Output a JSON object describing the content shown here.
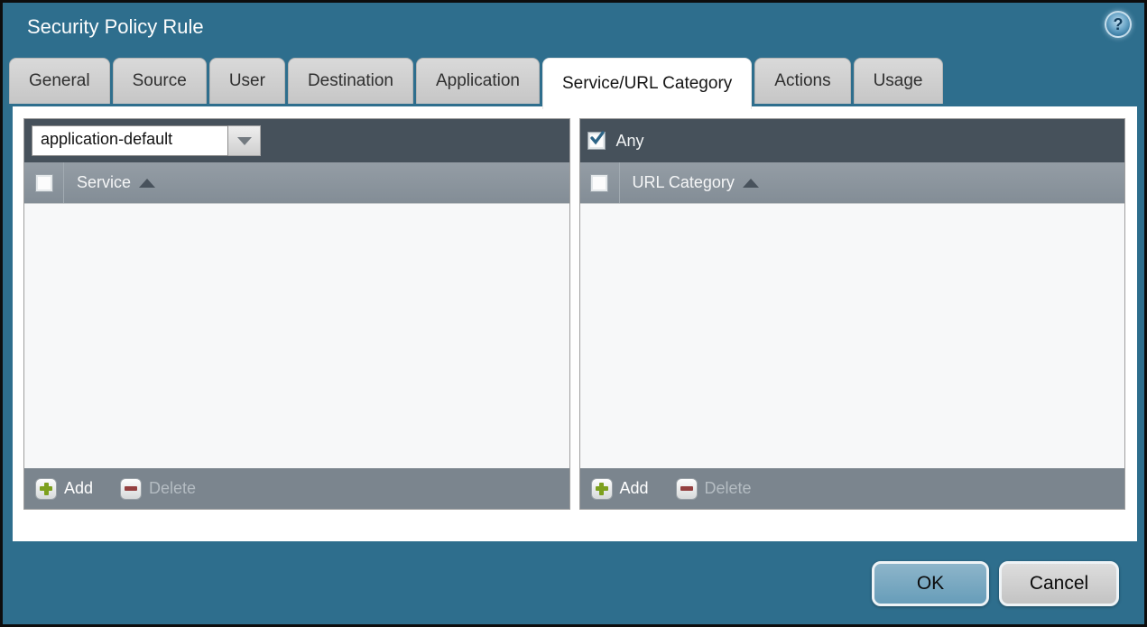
{
  "window": {
    "title": "Security Policy Rule"
  },
  "icons": {
    "help_glyph": "?"
  },
  "tabs": [
    {
      "label": "General",
      "active": false
    },
    {
      "label": "Source",
      "active": false
    },
    {
      "label": "User",
      "active": false
    },
    {
      "label": "Destination",
      "active": false
    },
    {
      "label": "Application",
      "active": false
    },
    {
      "label": "Service/URL Category",
      "active": true
    },
    {
      "label": "Actions",
      "active": false
    },
    {
      "label": "Usage",
      "active": false
    }
  ],
  "service_panel": {
    "dropdown_value": "application-default",
    "column_header": "Service",
    "sort_order": "ascending",
    "select_all_checked": false,
    "rows": [],
    "add_label": "Add",
    "delete_label": "Delete",
    "delete_enabled": false
  },
  "url_category_panel": {
    "any_label": "Any",
    "any_checked": true,
    "column_header": "URL Category",
    "sort_order": "ascending",
    "select_all_checked": false,
    "rows": [],
    "add_label": "Add",
    "delete_label": "Delete",
    "delete_enabled": false
  },
  "footer": {
    "ok_label": "OK",
    "cancel_label": "Cancel"
  },
  "colors": {
    "background_teal": "#2e6e8d",
    "panel_header_dark": "#46515b",
    "column_header_gray": "#8a949c",
    "toolbar_gray": "#7b858e",
    "list_background": "#f7f8f9",
    "active_tab": "#ffffff",
    "inactive_tab": "#cccccc",
    "ok_button": "#72a5c0",
    "cancel_button": "#cccccc",
    "add_icon_green": "#7da01e",
    "delete_icon_red": "#944040",
    "check_mark_blue": "#2d6486"
  }
}
